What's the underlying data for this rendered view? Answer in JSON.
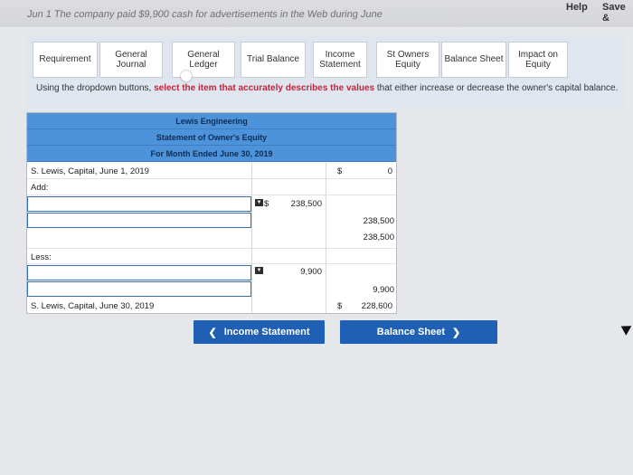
{
  "header": {
    "cut_text": "Jun 1 The company paid $9,900 cash for advertisements in the Web during June",
    "help_label": "Help",
    "save_label": "Save &"
  },
  "tabs": [
    {
      "label": "Requirement"
    },
    {
      "label": "General Journal"
    },
    {
      "label": "General Ledger"
    },
    {
      "label": "Trial Balance"
    },
    {
      "label": "Income Statement"
    },
    {
      "label": "St Owners Equity"
    },
    {
      "label": "Balance Sheet"
    },
    {
      "label": "Impact on Equity"
    }
  ],
  "instruction": {
    "prefix": "Using the dropdown buttons, ",
    "emphasis": "select the item that accurately describes the values",
    "suffix": " that either increase or decrease the owner's capital balance."
  },
  "statement": {
    "company": "Lewis Engineering",
    "title": "Statement of Owner's Equity",
    "period": "For Month Ended June 30, 2019",
    "opening_label": "S. Lewis, Capital, June 1, 2019",
    "opening_dollar": "$",
    "opening_value": "0",
    "add_label": "Add:",
    "add_dollar": "$",
    "add_value": "238,500",
    "add_subtotal_a": "238,500",
    "add_subtotal_b": "238,500",
    "less_label": "Less:",
    "less_value": "9,900",
    "less_subtotal": "9,900",
    "closing_label": "S. Lewis, Capital, June 30, 2019",
    "closing_dollar": "$",
    "closing_value": "228,600"
  },
  "nav": {
    "prev_label": "Income Statement",
    "next_label": "Balance Sheet"
  },
  "colors": {
    "header_blue": "#4d93d9",
    "button_blue": "#1f5fb4",
    "emphasis_red": "#c0253a"
  }
}
